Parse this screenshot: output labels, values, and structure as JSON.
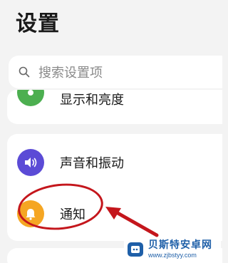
{
  "header": {
    "title": "设置"
  },
  "search": {
    "placeholder": "搜索设置项",
    "icon": "search-icon"
  },
  "settings": {
    "partial_item": {
      "label": "显示和亮度",
      "icon": "display-icon",
      "icon_color": "#4caf50"
    },
    "items": [
      {
        "label": "声音和振动",
        "icon": "speaker-icon",
        "icon_color": "#5b4bd6"
      },
      {
        "label": "通知",
        "icon": "bell-icon",
        "icon_color": "#f5a623"
      }
    ]
  },
  "annotation": {
    "highlight_color": "#c4161c",
    "target": "通知"
  },
  "watermark": {
    "brand": "贝斯特安卓网",
    "url": "www.zjbstyy.com"
  }
}
